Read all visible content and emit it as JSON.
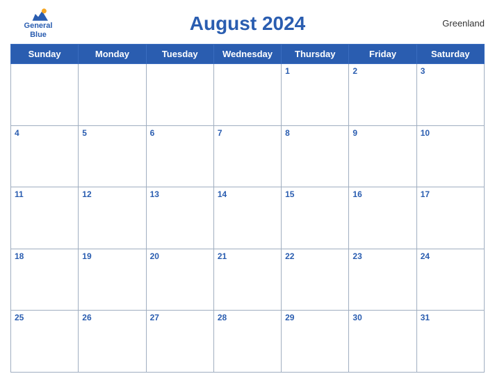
{
  "header": {
    "logo": {
      "line1": "General",
      "line2": "Blue"
    },
    "title": "August 2024",
    "country": "Greenland"
  },
  "weekdays": [
    "Sunday",
    "Monday",
    "Tuesday",
    "Wednesday",
    "Thursday",
    "Friday",
    "Saturday"
  ],
  "weeks": [
    [
      "",
      "",
      "",
      "",
      "1",
      "2",
      "3"
    ],
    [
      "4",
      "5",
      "6",
      "7",
      "8",
      "9",
      "10"
    ],
    [
      "11",
      "12",
      "13",
      "14",
      "15",
      "16",
      "17"
    ],
    [
      "18",
      "19",
      "20",
      "21",
      "22",
      "23",
      "24"
    ],
    [
      "25",
      "26",
      "27",
      "28",
      "29",
      "30",
      "31"
    ]
  ]
}
